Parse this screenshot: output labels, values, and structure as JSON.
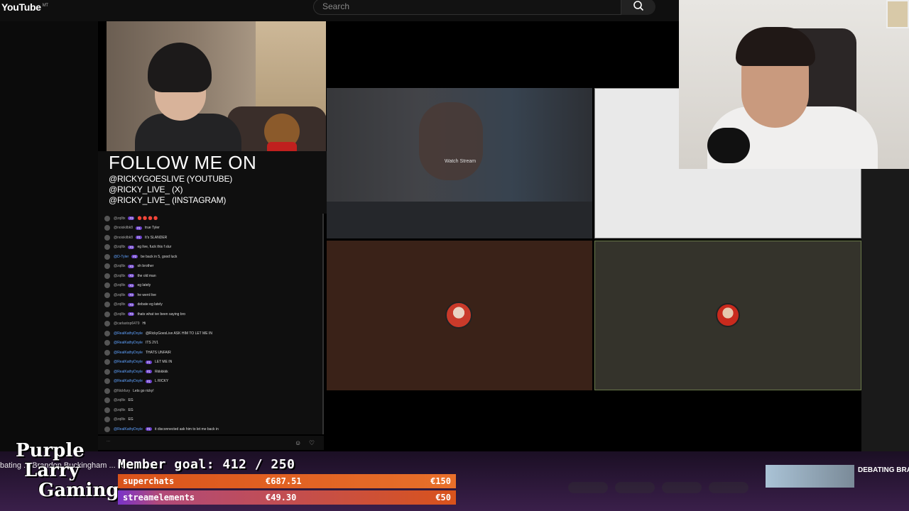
{
  "header": {
    "logo": "YouTube",
    "logo_sup": "MT",
    "search_placeholder": "Search"
  },
  "follow": {
    "title": "FOLLOW ME ON",
    "lines": [
      "@RICKYGOESLIVE (YOUTUBE)",
      "@RICKY_LIVE_ (X)",
      "@RICKY_LIVE_ (INSTAGRAM)"
    ]
  },
  "chat": {
    "messages": [
      {
        "user": "@zqlltx",
        "badge": "#3",
        "text": "🔴 🔴 🔴 🔴",
        "blue": false
      },
      {
        "user": "@noiskilbk8",
        "badge": "#1",
        "text": "true Tyler",
        "blue": false
      },
      {
        "user": "@noiskilbk8",
        "badge": "#1",
        "text": "It's SLANDER",
        "blue": false
      },
      {
        "user": "@zqlltx",
        "badge": "#3",
        "text": "eg live, fuck this f slur",
        "blue": false
      },
      {
        "user": "@D-Tyler",
        "badge": "#2",
        "text": "be back in 5, good luck",
        "blue": true
      },
      {
        "user": "@zqlltx",
        "badge": "#3",
        "text": "oh brother",
        "blue": false
      },
      {
        "user": "@zqlltx",
        "badge": "#3",
        "text": "the old man",
        "blue": false
      },
      {
        "user": "@zqlltx",
        "badge": "#3",
        "text": "eg lately",
        "blue": false
      },
      {
        "user": "@zqlltx",
        "badge": "#3",
        "text": "he went live",
        "blue": false
      },
      {
        "user": "@zqlltx",
        "badge": "#3",
        "text": "debate eg lately",
        "blue": false
      },
      {
        "user": "@zqlltx",
        "badge": "#3",
        "text": "thats what ive been saying bro",
        "blue": false
      },
      {
        "user": "@carlastop6479",
        "badge": "",
        "text": "Hi",
        "blue": false
      },
      {
        "user": "@RealKathyDoyle",
        "badge": "",
        "text": "@RickyGoesLive ASK HIM TO LET ME IN",
        "blue": true
      },
      {
        "user": "@RealKathyDoyle",
        "badge": "",
        "text": "ITS 2V1",
        "blue": true
      },
      {
        "user": "@RealKathyDoyle",
        "badge": "",
        "text": "THATS UNFAIR",
        "blue": true
      },
      {
        "user": "@RealKathyDoyle",
        "badge": "#1",
        "text": "LET ME IN",
        "blue": true
      },
      {
        "user": "@RealKathyDoyle",
        "badge": "#1",
        "text": "Rkkkkkk",
        "blue": true
      },
      {
        "user": "@RealKathyDoyle",
        "badge": "#1",
        "text": "L RICKY",
        "blue": true
      },
      {
        "user": "@Nickfury",
        "badge": "",
        "text": "Lets go ricky!",
        "blue": false
      },
      {
        "user": "@zqlltx",
        "badge": "",
        "text": "EG",
        "blue": false
      },
      {
        "user": "@zqlltx",
        "badge": "",
        "text": "EG",
        "blue": false
      },
      {
        "user": "@zqlltx",
        "badge": "",
        "text": "EG",
        "blue": false
      },
      {
        "user": "@RealKathyDoyle",
        "badge": "#1",
        "text": "it disconnected ask him to let me back in",
        "blue": true
      }
    ]
  },
  "stream": {
    "watch_label": "Watch Stream"
  },
  "overlay": {
    "logo_lines": [
      "Purple",
      "Larry",
      "Gaming"
    ],
    "ticker": "bating ... Brandon Buckingham ... Ricky Live",
    "member_goal": "Member goal: 412 / 250",
    "bars": [
      {
        "label": "superchats",
        "value": "€687.51",
        "target": "€150"
      },
      {
        "label": "streamelements",
        "value": "€49.30",
        "target": "€50"
      }
    ],
    "recommended_title": "DEBATING BRANDON BUCKINGHAM"
  },
  "colors": {
    "accent_purple": "#6a3fc9",
    "bar_orange": "#d9531b",
    "brown_tile": "#3a2218",
    "olive_tile": "#34332b"
  }
}
